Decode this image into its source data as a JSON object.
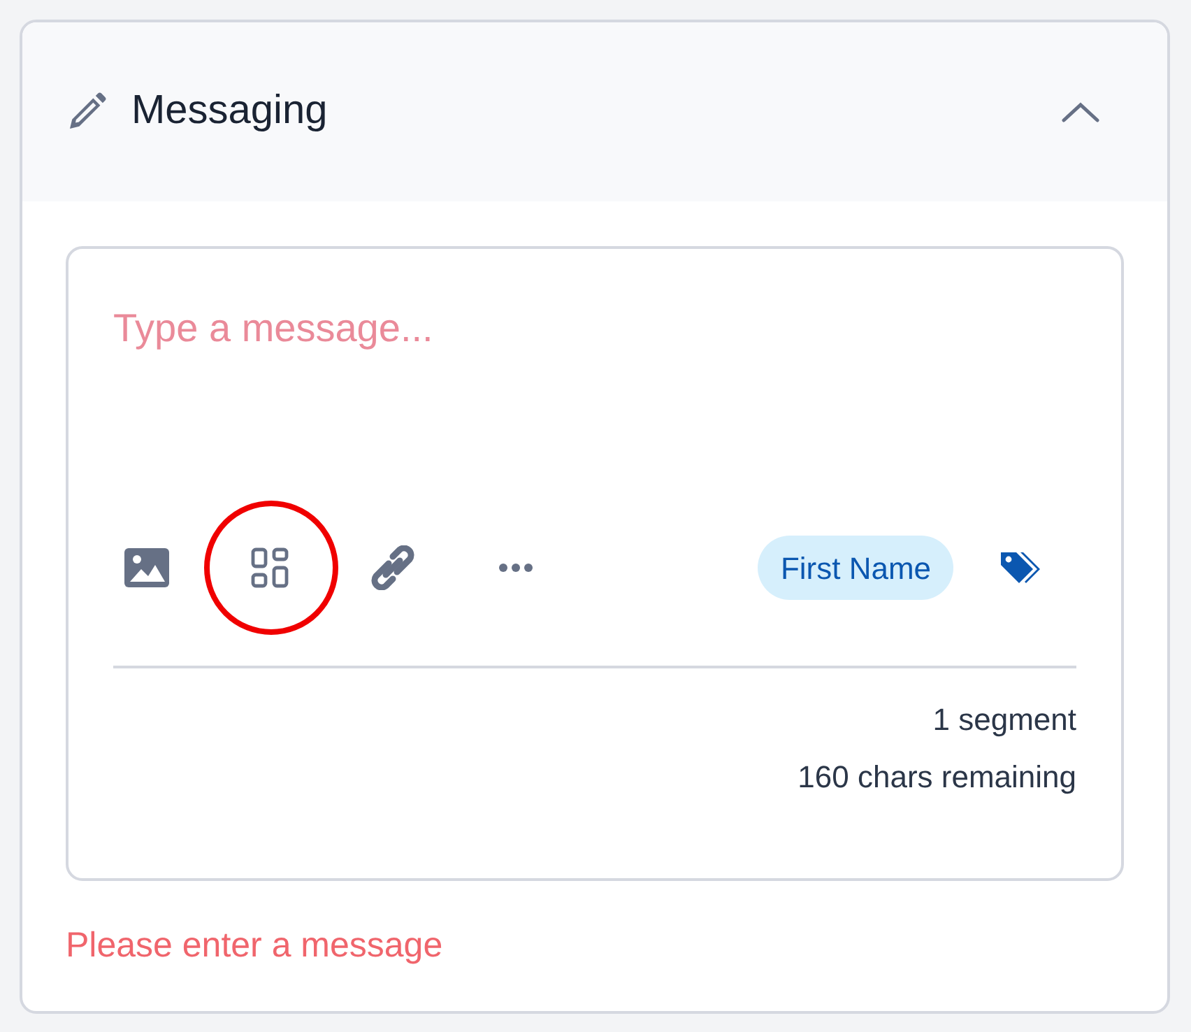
{
  "panel": {
    "title": "Messaging",
    "expanded": true
  },
  "message": {
    "placeholder": "Type a message..."
  },
  "toolbar": [
    {
      "kind": "image",
      "highlighted": false
    },
    {
      "kind": "template",
      "highlighted": true
    },
    {
      "kind": "link",
      "highlighted": false
    },
    {
      "kind": "more",
      "highlighted": false
    }
  ],
  "merge_field": {
    "label": "First Name"
  },
  "counter": {
    "segments": "1 segment",
    "remaining": "160 chars remaining"
  },
  "error": "Please enter a message"
}
